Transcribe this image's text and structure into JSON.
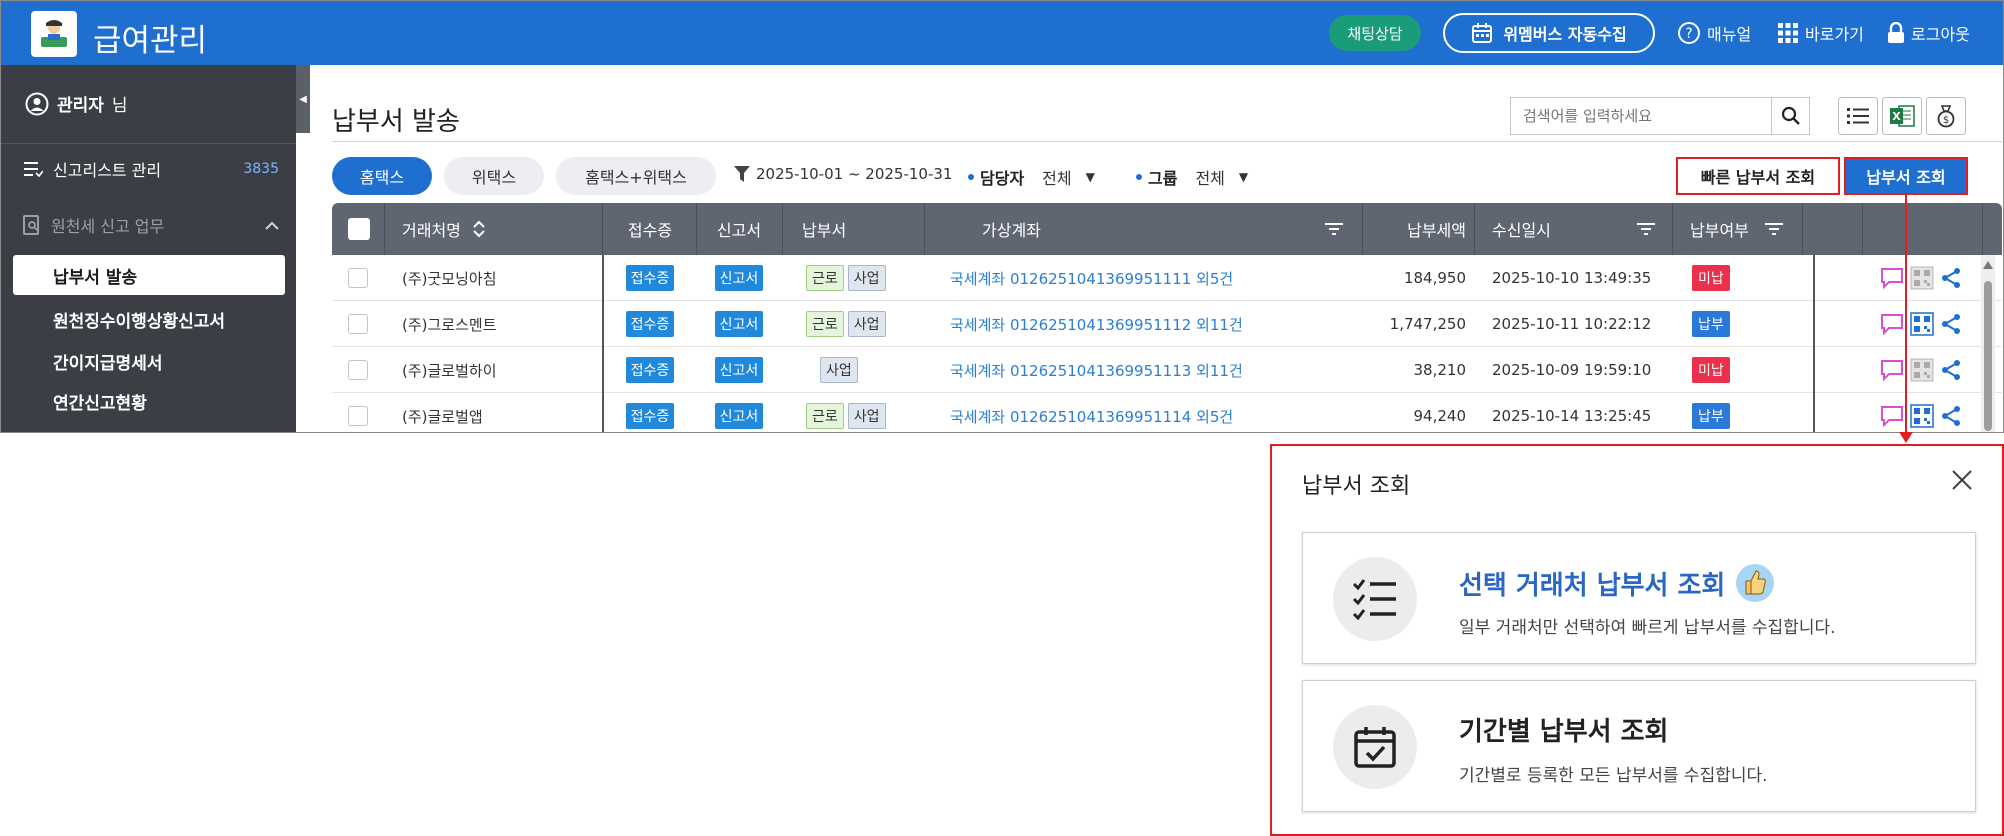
{
  "app": {
    "title": "급여관리",
    "chat_label": "채팅상담",
    "auto_collect_label": "위멤버스 자동수집",
    "manual_label": "매뉴얼",
    "shortcut_label": "바로가기",
    "logout_label": "로그아웃"
  },
  "sidebar": {
    "admin_name": "관리자",
    "admin_suffix": "님",
    "report_list_label": "신고리스트 관리",
    "report_list_count": "3835",
    "group_label": "원천세 신고 업무",
    "items": [
      {
        "label": "납부서 발송"
      },
      {
        "label": "원천징수이행상황신고서"
      },
      {
        "label": "간이지급명세서"
      },
      {
        "label": "연간신고현황"
      }
    ]
  },
  "page": {
    "title": "납부서 발송",
    "search_placeholder": "검색어를 입력하세요"
  },
  "filters": {
    "tabs": [
      {
        "label": "홈택스",
        "active": true
      },
      {
        "label": "위택스",
        "active": false
      },
      {
        "label": "홈택스+위택스",
        "active": false
      }
    ],
    "date_range": "2025-10-01 ~ 2025-10-31",
    "manager_label": "담당자",
    "manager_value": "전체",
    "group_label": "그룹",
    "group_value": "전체",
    "quick_query_label": "빠른 납부서 조회",
    "query_label": "납부서 조회"
  },
  "table": {
    "headers": {
      "client": "거래처명",
      "receipt": "접수증",
      "report": "신고서",
      "payment": "납부서",
      "account": "가상계좌",
      "amount": "납부세액",
      "received": "수신일시",
      "paid": "납부여부"
    },
    "rows": [
      {
        "client": "(주)굿모닝아침",
        "receipt": "접수증",
        "report": "신고서",
        "tags": [
          "근로",
          "사업"
        ],
        "account": "국세계좌 0126251041369951111 외5건",
        "amount": "184,950",
        "received": "2025-10-10 13:49:35",
        "status": "미납"
      },
      {
        "client": "(주)그로스멘트",
        "receipt": "접수증",
        "report": "신고서",
        "tags": [
          "근로",
          "사업"
        ],
        "account": "국세계좌 0126251041369951112 외11건",
        "amount": "1,747,250",
        "received": "2025-10-11 10:22:12",
        "status": "납부"
      },
      {
        "client": "(주)글로벌하이",
        "receipt": "접수증",
        "report": "신고서",
        "tags": [
          "사업"
        ],
        "account": "국세계좌 0126251041369951113 외11건",
        "amount": "38,210",
        "received": "2025-10-09 19:59:10",
        "status": "미납"
      },
      {
        "client": "(주)글로벌앱",
        "receipt": "접수증",
        "report": "신고서",
        "tags": [
          "근로",
          "사업"
        ],
        "account": "국세계좌 0126251041369951114 외5건",
        "amount": "94,240",
        "received": "2025-10-14 13:25:45",
        "status": "납부"
      }
    ]
  },
  "popup": {
    "title": "납부서 조회",
    "options": [
      {
        "title": "선택 거래처 납부서 조회",
        "desc": "일부 거래처만 선택하여 빠르게 납부서를 수집합니다.",
        "icon": "checklist-icon"
      },
      {
        "title": "기간별 납부서 조회",
        "desc": "기간별로 등록한 모든 납부서를 수집합니다.",
        "icon": "calendar-check-icon"
      }
    ]
  },
  "colors": {
    "brand_blue": "#1e6fd0",
    "sidebar_dark": "#3b3f45",
    "unpaid_red": "#ec2f4b",
    "highlight_red": "#e02020"
  }
}
